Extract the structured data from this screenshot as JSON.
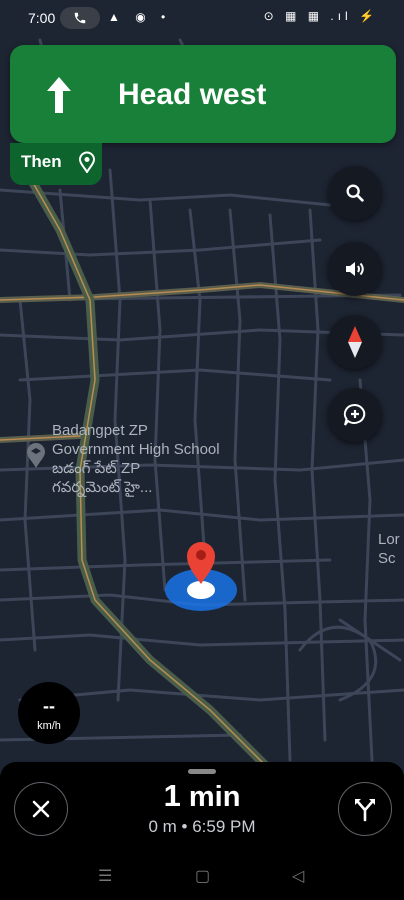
{
  "status_bar": {
    "time": "7:00",
    "call_indicator": "phone-icon",
    "left_icons": "▲ ◉ •",
    "right_icons": "⊙ ▦ ▦ .ıl ⚡"
  },
  "navigation": {
    "instruction": "Head west",
    "direction_icon": "arrow-up-icon",
    "then_label": "Then"
  },
  "map": {
    "poi_name_line1": "Badangpet ZP",
    "poi_name_line2": "Government High School",
    "poi_local_line1": "బడంగ్ పేట్ ZP",
    "poi_local_line2": "గవర్నమెంట్ హై...",
    "right_place_line1": "Lor",
    "right_place_line2": "Sc"
  },
  "controls": {
    "search_icon": "search-icon",
    "sound_icon": "volume-icon",
    "compass_icon": "compass-icon",
    "report_icon": "add-report-icon"
  },
  "speedometer": {
    "value": "--",
    "unit": "km/h"
  },
  "trip": {
    "eta_number": "1",
    "eta_unit": " min",
    "distance": "0 m",
    "separator": " • ",
    "arrival_time": "6:59 PM"
  },
  "colors": {
    "banner": "#188038",
    "then": "#0d652d",
    "map_bg": "#1d2432",
    "road": "#4a5568",
    "route_main": "#6b7a5a",
    "pin": "#ea4335",
    "location": "#1a73e8"
  }
}
